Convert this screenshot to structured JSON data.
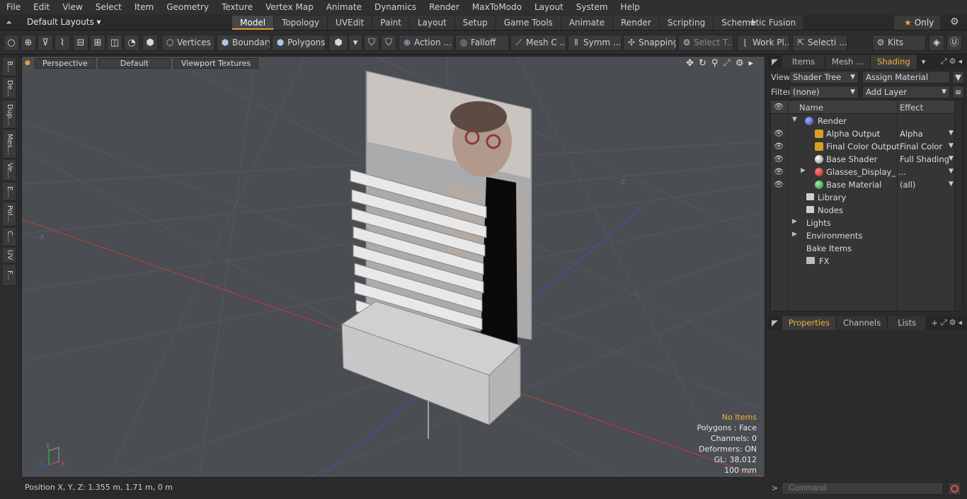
{
  "menu": [
    "File",
    "Edit",
    "View",
    "Select",
    "Item",
    "Geometry",
    "Texture",
    "Vertex Map",
    "Animate",
    "Dynamics",
    "Render",
    "MaxToModo",
    "Layout",
    "System",
    "Help"
  ],
  "layout": {
    "default_layouts": "Default Layouts ▾",
    "tabs": [
      "Model",
      "Topology",
      "UVEdit",
      "Paint",
      "Layout",
      "Setup",
      "Game Tools",
      "Animate",
      "Render",
      "Scripting",
      "Schematic Fusion"
    ],
    "plus": "+",
    "only": "Only"
  },
  "toolbar": {
    "vertices": "Vertices",
    "boundary": "Boundary",
    "polygons": "Polygons",
    "action": "Action ...",
    "falloff": "Falloff",
    "mesh_c": "Mesh C ...",
    "symm": "Symm ...",
    "snapping": "Snapping",
    "select_t": "Select T...",
    "work_pl": "Work Pl...",
    "selecti": "Selecti ...",
    "kits": "Kits"
  },
  "left_strip": [
    "B...",
    "De...",
    "Dup...",
    "Mes...",
    "Ve...",
    "E...",
    "Pol...",
    "C...",
    "UV",
    "F..."
  ],
  "viewport": {
    "perspective": "Perspective",
    "default": "Default",
    "textures": "Viewport Textures",
    "info": {
      "no_items": "No Items",
      "polygons": "Polygons : Face",
      "channels": "Channels: 0",
      "deformers": "Deformers: ON",
      "gl": "GL: 38,012",
      "scale": "100 mm"
    },
    "axis_labels": {
      "y": "Y",
      "z": "Z",
      "x": "X",
      "neg_x": "-X",
      "neg_z": "-Z"
    }
  },
  "status": "Position X, Y, Z:   1.355 m, 1.71 m, 0 m",
  "panel_top": {
    "tabs": [
      "Items",
      "Mesh ...",
      "Shading"
    ],
    "view_label": "View",
    "view_value": "Shader Tree",
    "assign": "Assign Material",
    "filter_label": "Filter",
    "filter_value": "(none)",
    "add_layer": "Add Layer",
    "col_name": "Name",
    "col_effect": "Effect",
    "tree": [
      {
        "name": "Render",
        "effect": ""
      },
      {
        "name": "Alpha Output",
        "effect": "Alpha"
      },
      {
        "name": "Final Color Output",
        "effect": "Final Color"
      },
      {
        "name": "Base Shader",
        "effect": "Full Shading"
      },
      {
        "name": "Glasses_Display_ ...",
        "effect": ""
      },
      {
        "name": "Base Material",
        "effect": "(all)"
      },
      {
        "name": "Library",
        "effect": ""
      },
      {
        "name": "Nodes",
        "effect": ""
      },
      {
        "name": "Lights",
        "effect": ""
      },
      {
        "name": "Environments",
        "effect": ""
      },
      {
        "name": "Bake Items",
        "effect": ""
      },
      {
        "name": "FX",
        "effect": ""
      }
    ]
  },
  "panel_bottom": {
    "tabs": [
      "Properties",
      "Channels",
      "Lists"
    ],
    "plus": "+"
  },
  "command_placeholder": "Command",
  "colors": {
    "accent": "#f0b040",
    "viewport_bg": "#4a4d51",
    "red_axis": "#b04040",
    "blue_axis": "#4050b0"
  }
}
